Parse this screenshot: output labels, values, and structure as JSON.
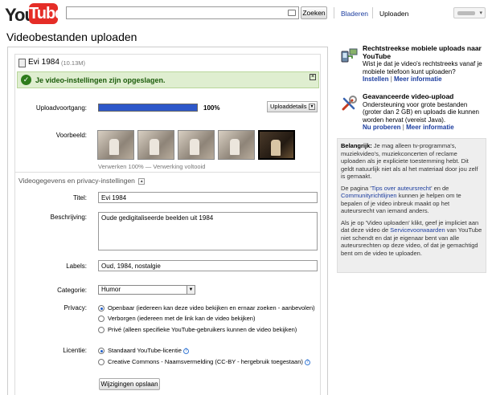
{
  "header": {
    "logo_you": "You",
    "logo_tube": "Tube",
    "search_button": "Zoeken",
    "nav_browse": "Bladeren",
    "nav_upload": "Uploaden"
  },
  "page_title": "Videobestanden uploaden",
  "file": {
    "name": "Evi 1984",
    "size": "(10.13M)"
  },
  "success_message": "Je video-instellingen zijn opgeslagen.",
  "upload": {
    "progress_label": "Uploadvoortgang:",
    "progress_percent": "100%",
    "progress_value": 100,
    "details_button": "Uploaddetails"
  },
  "preview": {
    "label": "Voorbeeld:",
    "caption": "Verwerken 100% — Verwerking voltooid",
    "thumbnail_count": 5,
    "selected_index": 4
  },
  "section_title": "Videogegevens en privacy-instellingen",
  "form": {
    "title_label": "Titel:",
    "title_value": "Evi 1984",
    "description_label": "Beschrijving:",
    "description_value": "Oude gedigitaliseerde beelden uit 1984",
    "tags_label": "Labels:",
    "tags_value": "Oud, 1984, nostalgie",
    "category_label": "Categorie:",
    "category_value": "Humor",
    "privacy_label": "Privacy:",
    "privacy_options": [
      "Openbaar (iedereen kan deze video bekijken en ernaar zoeken - aanbevolen)",
      "Verborgen (iedereen met de link kan de video bekijken)",
      "Privé (alleen specifieke YouTube-gebruikers kunnen de video bekijken)"
    ],
    "privacy_selected": 0,
    "license_label": "Licentie:",
    "license_options": [
      "Standaard YouTube-licentie",
      "Creative Commons - Naamsvermelding (CC-BY - hergebruik toegestaan)"
    ],
    "license_selected": 0,
    "save_button": "Wijzigingen opslaan"
  },
  "sidebar": {
    "mobile": {
      "title": "Rechtstreekse mobiele uploads naar YouTube",
      "text": "Wist je dat je video's rechtstreeks vanaf je mobiele telefoon kunt uploaden?",
      "link_1": "Instellen",
      "link_2": "Meer informatie",
      "separator": "|"
    },
    "advanced": {
      "title": "Geavanceerde video-upload",
      "text": "Ondersteuning voor grote bestanden (groter dan 2 GB) en uploads die kunnen worden hervat (vereist Java).",
      "link_1": "Nu proberen",
      "link_2": "Meer informatie",
      "separator": "|"
    },
    "notice": {
      "p1_bold": "Belangrijk:",
      "p1_text": " Je mag alleen tv-programma's, muziekvideo's, muziekconcerten of reclame uploaden als je expliciete toestemming hebt. Dit geldt natuurlijk niet als al het materiaal door jou zelf is gemaakt.",
      "p2_pre": "De pagina '",
      "p2_link1": "Tips over auteursrecht",
      "p2_mid": "' en de ",
      "p2_link2": "Communityrichtlijnen",
      "p2_post": " kunnen je helpen om te bepalen of je video inbreuk maakt op het auteursrecht van iemand anders.",
      "p3_pre": "Als je op 'Video uploaden' klikt, geef je impliciet aan dat deze video de ",
      "p3_link": "Servicevoorwaarden",
      "p3_post": " van YouTube niet schendt en dat je eigenaar bent van alle auteursrechten op deze video, of dat je gemachtigd bent om de video te uploaden."
    }
  },
  "colors": {
    "brand_red": "#e52d27",
    "link_blue": "#1c3d9f",
    "progress_blue": "#2d57c9",
    "success_bg": "#dfeed0",
    "success_text": "#1b5b0a"
  }
}
